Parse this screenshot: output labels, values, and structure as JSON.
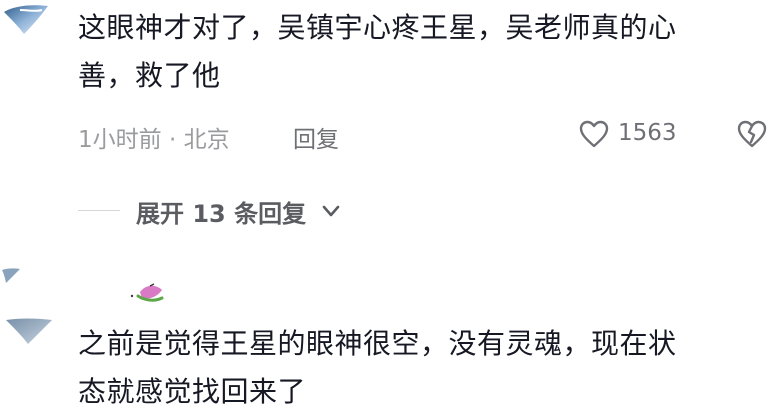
{
  "comments": [
    {
      "text_line1": "这眼神才对了，吴镇宇心疼王星，吴老师真的心",
      "text_line2": "善，救了他",
      "time_location": "1小时前 · 北京",
      "reply_label": "回复",
      "like_count": "1563",
      "expand_label": "展开 13 条回复"
    },
    {
      "text_line1": "之前是觉得王星的眼神很空，没有灵魂，现在状",
      "text_line2": "态就感觉找回来了"
    }
  ],
  "icons": {
    "like": "heart-outline-icon",
    "dislike": "broken-heart-icon",
    "expand": "chevron-down-icon"
  },
  "colors": {
    "text_primary": "#161823",
    "text_secondary": "#9a9b9e",
    "text_action": "#6f7075"
  }
}
